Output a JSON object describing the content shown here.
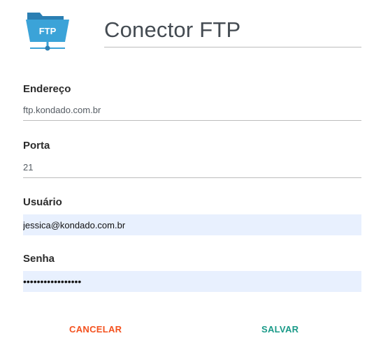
{
  "app": {
    "logo_text": "FTP",
    "title": "Conector FTP"
  },
  "form": {
    "address": {
      "label": "Endereço",
      "value": "ftp.kondado.com.br"
    },
    "port": {
      "label": "Porta",
      "value": "21"
    },
    "user": {
      "label": "Usuário",
      "value": "jessica@kondado.com.br"
    },
    "password": {
      "label": "Senha",
      "value": "•••••••••••••••••"
    }
  },
  "actions": {
    "cancel_label": "CANCELAR",
    "save_label": "SALVAR"
  },
  "colors": {
    "logo_blue": "#3ba3d8",
    "logo_dark": "#2b7fb3",
    "cancel": "#f4511e",
    "save": "#1a9a88",
    "autofill_bg": "#e8f0fe"
  }
}
